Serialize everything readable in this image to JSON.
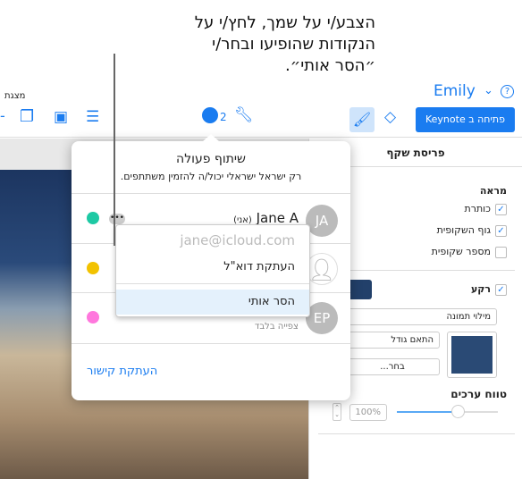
{
  "callout": {
    "lines": [
      "הצבע/י על שמך, לחץ/י על",
      "הנקודות שהופיעו ובחר/י",
      "״הסר אותי״."
    ]
  },
  "toolbar": {
    "left_label": "מצגת",
    "user": "Emily",
    "collab_count": "2",
    "open_keynote": "פתיחה ב Keynote",
    "icons": [
      "shape-icon",
      "media-icon",
      "text-icon",
      "collaborate-icon",
      "wrench-icon",
      "format-brush-icon",
      "animate-icon",
      "help-icon"
    ]
  },
  "panel": {
    "title": "פריסת שקף",
    "appearance": "מראה",
    "opts": [
      {
        "label": "כותרת",
        "checked": true
      },
      {
        "label": "גוף השקופית",
        "checked": true
      },
      {
        "label": "מספר שקופית",
        "checked": false
      }
    ],
    "background": "רקע",
    "fill": "מילוי תמונה",
    "scale": "התאם גודל",
    "choose": "בחר...",
    "range": "טווח ערכים",
    "percent": "100%",
    "slider_value": 0.6
  },
  "popover": {
    "title": "שיתוף פעולה",
    "subtitle": "רק ישראל ישראלי יכול/ה להזמין משתתפים.",
    "participants": [
      {
        "initials": "JA",
        "name": "Jane A",
        "me": "(אני)",
        "color": "#1dc9a4"
      },
      {
        "initials": "",
        "name": "",
        "color": "#f2c200"
      },
      {
        "initials": "EP",
        "name": "",
        "status": "צפייה בלבד",
        "color": "#ff77dd"
      }
    ],
    "copy_link": "העתקת קישור"
  },
  "menu": {
    "email": "jane@icloud.com",
    "copy_email": "העתקת דוא\"ל",
    "remove_me": "הסר אותי"
  },
  "colors": {
    "accent": "#1a7cf0",
    "menu_highlight": "#e4f1fc"
  }
}
